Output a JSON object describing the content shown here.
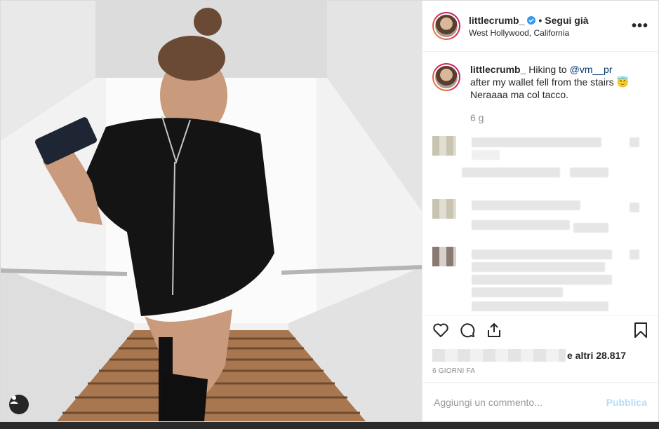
{
  "post": {
    "username": "littlecrumb_",
    "follow_label": "Segui già",
    "separator": "•",
    "location": "West Hollywood, California",
    "more_label": "•••",
    "caption_username": "littlecrumb_",
    "caption_text_1": "Hiking to",
    "caption_mention": "@vm__pr",
    "caption_line_2": "after my wallet fell from the stairs 😇",
    "caption_line_3": "Neraaaa ma col tacco.",
    "caption_age": "6 g",
    "likes_suffix": "e altri 28.817",
    "date": "6 GIORNI FA",
    "comment_placeholder": "Aggiungi un commento...",
    "publish_label": "Pubblica"
  },
  "colors": {
    "verified": "#3897f0",
    "mention": "#003569",
    "publish_disabled": "#b2dffc"
  },
  "icons": [
    "heart-icon",
    "comment-icon",
    "share-icon",
    "bookmark-icon",
    "user-tag-icon",
    "verified-icon",
    "more-icon"
  ]
}
